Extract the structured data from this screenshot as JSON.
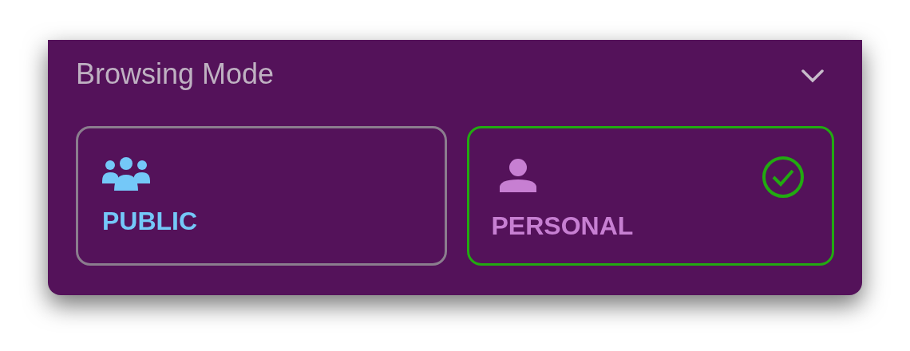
{
  "panel": {
    "title": "Browsing Mode"
  },
  "modes": [
    {
      "label": "PUBLIC",
      "kind": "group",
      "selected": false,
      "color": "#74c8f8"
    },
    {
      "label": "PERSONAL",
      "kind": "person",
      "selected": true,
      "color": "#c77fd2"
    }
  ]
}
